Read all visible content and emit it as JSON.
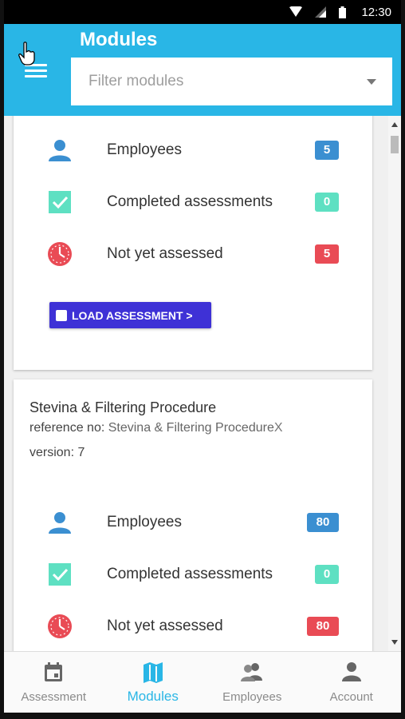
{
  "status_bar": {
    "time": "12:30"
  },
  "header": {
    "title": "Modules",
    "filter_placeholder": "Filter modules"
  },
  "card1": {
    "rows": [
      {
        "label": "Employees",
        "count": "5",
        "color": "#3b8fd1",
        "icon": "person-icon"
      },
      {
        "label": "Completed assessments",
        "count": "0",
        "color": "#5ee0c2",
        "icon": "check-box-icon"
      },
      {
        "label": "Not yet assessed",
        "count": "5",
        "color": "#e94b55",
        "icon": "clock-icon"
      }
    ],
    "load_button": "LOAD ASSESSMENT >"
  },
  "card2": {
    "title": "Stevina & Filtering Procedure",
    "reference_label": "reference no:",
    "reference_value": "Stevina & Filtering Procedure",
    "reference_suffix": "X",
    "version": "version: 7",
    "rows": [
      {
        "label": "Employees",
        "count": "80",
        "color": "#3b8fd1",
        "icon": "person-icon"
      },
      {
        "label": "Completed assessments",
        "count": "0",
        "color": "#5ee0c2",
        "icon": "check-box-icon"
      },
      {
        "label": "Not yet assessed",
        "count": "80",
        "color": "#e94b55",
        "icon": "clock-icon"
      }
    ]
  },
  "bottom_nav": {
    "items": [
      {
        "label": "Assessment",
        "icon": "calendar-icon"
      },
      {
        "label": "Modules",
        "icon": "map-icon",
        "active": true
      },
      {
        "label": "Employees",
        "icon": "people-icon"
      },
      {
        "label": "Account",
        "icon": "person-icon"
      }
    ]
  },
  "colors": {
    "primary": "#29b6e6",
    "button": "#3e31d6"
  }
}
